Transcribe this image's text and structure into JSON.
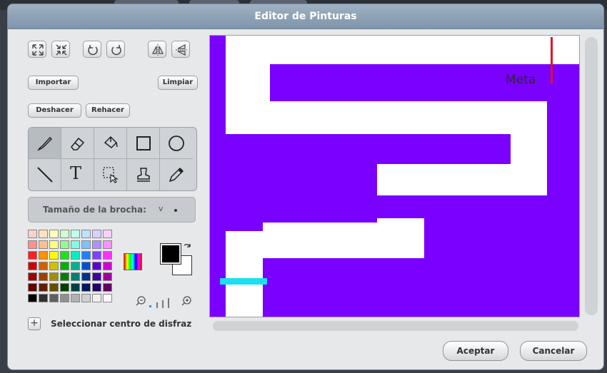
{
  "window": {
    "title": "Editor de Pinturas"
  },
  "transform_tools": [
    {
      "name": "grow-icon"
    },
    {
      "name": "shrink-icon"
    },
    {
      "name": "rotate-left-icon"
    },
    {
      "name": "rotate-right-icon"
    },
    {
      "name": "flip-horizontal-icon"
    },
    {
      "name": "flip-vertical-icon"
    }
  ],
  "buttons": {
    "import": "Importar",
    "clear": "Limpiar",
    "undo": "Deshacer",
    "redo": "Rehacer",
    "accept": "Aceptar",
    "cancel": "Cancelar"
  },
  "tools": [
    {
      "name": "paintbrush-icon",
      "selected": true
    },
    {
      "name": "eraser-icon"
    },
    {
      "name": "fill-bucket-icon"
    },
    {
      "name": "rectangle-icon"
    },
    {
      "name": "ellipse-icon"
    },
    {
      "name": "line-icon"
    },
    {
      "name": "text-icon",
      "glyph": "T"
    },
    {
      "name": "select-icon"
    },
    {
      "name": "stamp-icon"
    },
    {
      "name": "eyedropper-icon"
    }
  ],
  "brush": {
    "label": "Tamaño de la brocha:",
    "chevron": "v"
  },
  "colors": {
    "foreground": "#000000",
    "background": "#ffffff",
    "canvas_fill": "#7a00ff",
    "marker": "#19e1f0",
    "goal_line": "#e0102a"
  },
  "palette": [
    [
      "#ffd0d0",
      "#ffe0c0",
      "#ffffc0",
      "#d0ffd0",
      "#c0fff0",
      "#c0e0ff",
      "#d8d0ff",
      "#ffd0ff"
    ],
    [
      "#ff9090",
      "#ffc090",
      "#ffff80",
      "#90ff90",
      "#80ffe0",
      "#80c0ff",
      "#b090ff",
      "#ff90ff"
    ],
    [
      "#ff2020",
      "#ff9000",
      "#ffff00",
      "#20e020",
      "#00f0c0",
      "#2080ff",
      "#8040ff",
      "#ff30ff"
    ],
    [
      "#d00000",
      "#d06000",
      "#d0c000",
      "#00b000",
      "#00b090",
      "#0050d0",
      "#6000d0",
      "#d000d0"
    ],
    [
      "#a00000",
      "#a04000",
      "#a09000",
      "#008000",
      "#008070",
      "#003090",
      "#4000a0",
      "#a000a0"
    ],
    [
      "#600000",
      "#602000",
      "#605000",
      "#004000",
      "#004040",
      "#001860",
      "#200060",
      "#600060"
    ],
    [
      "#000000",
      "#303030",
      "#606060",
      "#909090",
      "#b0b0b0",
      "#d0d0d0",
      "#f0f0f0",
      "#ffffff"
    ]
  ],
  "canvas": {
    "text": "Meta"
  },
  "footer": {
    "center_label": "Seleccionar centro de disfraz",
    "plus": "+"
  }
}
